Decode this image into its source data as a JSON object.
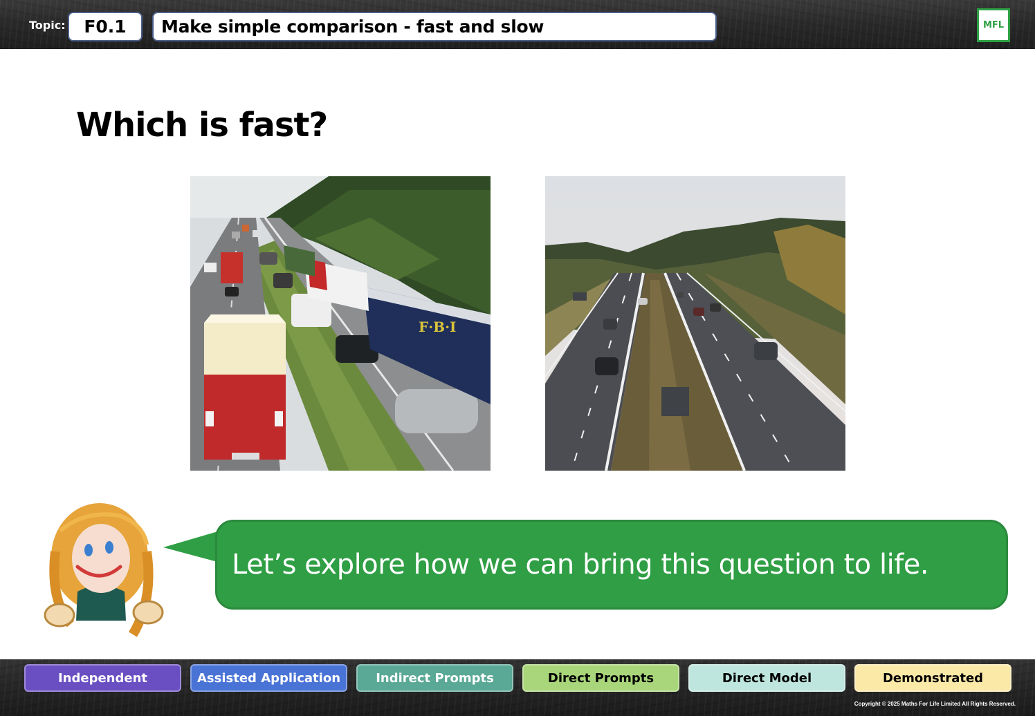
{
  "header": {
    "topic_label": "Topic:",
    "topic_code": "F0.1",
    "topic_title": "Make simple comparison - fast and slow",
    "logo_text": "MFL"
  },
  "main": {
    "heading": "Which is fast?",
    "images": [
      {
        "name": "traffic-jam-photo",
        "description_icon": "photo"
      },
      {
        "name": "open-highway-photo",
        "description_icon": "photo"
      }
    ]
  },
  "speech_bubble": {
    "text": "Let’s explore how we can bring this question to life."
  },
  "footer": {
    "levels": [
      {
        "label": "Independent",
        "color": "#6a4fc2",
        "text_color": "#ffffff"
      },
      {
        "label": "Assisted Application",
        "color": "#4a73d6",
        "text_color": "#ffffff"
      },
      {
        "label": "Indirect Prompts",
        "color": "#5aa896",
        "text_color": "#ffffff"
      },
      {
        "label": "Direct Prompts",
        "color": "#a9d67a",
        "text_color": "#000000"
      },
      {
        "label": "Direct Model",
        "color": "#bfe6de",
        "text_color": "#000000"
      },
      {
        "label": "Demonstrated",
        "color": "#fbe9a8",
        "text_color": "#000000"
      }
    ],
    "copyright": "Copyright © 2025 Maths For Life Limited All Rights Reserved."
  },
  "colors": {
    "bubble_green": "#2f9e44",
    "logo_green": "#2ea043",
    "box_border": "#4a5f8a"
  }
}
